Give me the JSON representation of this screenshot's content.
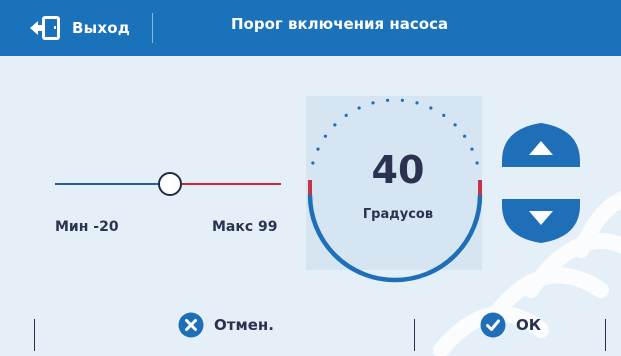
{
  "header": {
    "exit_label": "Выход",
    "title": "Порог включения насоса",
    "exit_icon": "exit-door-icon"
  },
  "slider": {
    "min_label": "Мин -20",
    "max_label": "Макс 99",
    "min": -20,
    "max": 99,
    "value": 40,
    "left_color": "#2a5ea3",
    "right_color": "#d3253a"
  },
  "dial": {
    "value": "40",
    "unit": "Градусов",
    "arc_color": "#1e6fb8",
    "accent_color": "#c5344a"
  },
  "controls": {
    "up_icon": "triangle-up-icon",
    "down_icon": "triangle-down-icon"
  },
  "footer": {
    "cancel_label": "Отмен.",
    "ok_label": "ОК",
    "cancel_icon": "close-circle-icon",
    "ok_icon": "check-circle-icon"
  },
  "colors": {
    "header_bg": "#1a73ba",
    "screen_bg": "#e4eff8",
    "button_blue": "#1e6fb8"
  }
}
